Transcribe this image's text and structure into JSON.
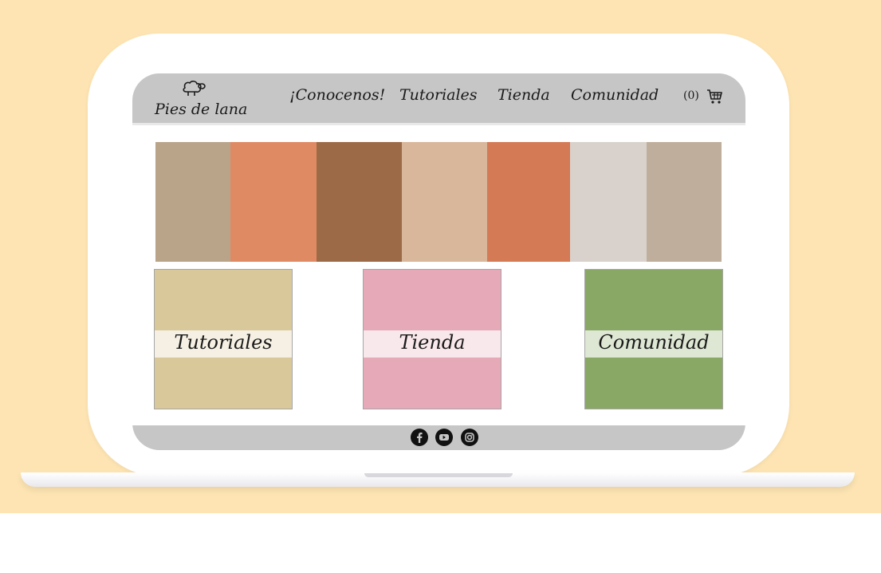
{
  "site": {
    "logo_text": "Pies de lana"
  },
  "nav": {
    "items": [
      {
        "label": "¡Conocenos!"
      },
      {
        "label": "Tutoriales"
      },
      {
        "label": "Tienda"
      },
      {
        "label": "Comunidad"
      }
    ]
  },
  "cart": {
    "count_text": "(0)",
    "icon": "shopping-cart-icon"
  },
  "banner": {
    "tiles": [
      {
        "color": "#b9a48a"
      },
      {
        "color": "#e08a63"
      },
      {
        "color": "#9c6a46"
      },
      {
        "color": "#d8b79a"
      },
      {
        "color": "#d47a55"
      },
      {
        "color": "#d9d2cc"
      },
      {
        "color": "#bfae9c"
      }
    ]
  },
  "cards": [
    {
      "label": "Tutoriales",
      "color": "#d9c99a"
    },
    {
      "label": "Tienda",
      "color": "#e6a9b8"
    },
    {
      "label": "Comunidad",
      "color": "#8aa865"
    }
  ],
  "footer": {
    "social_icons": [
      "facebook-icon",
      "youtube-icon",
      "instagram-icon"
    ]
  },
  "colors": {
    "background": "#fde4b2",
    "header": "#c6c6c6",
    "footer": "#c6c6c6",
    "text": "#1a1a1a"
  }
}
